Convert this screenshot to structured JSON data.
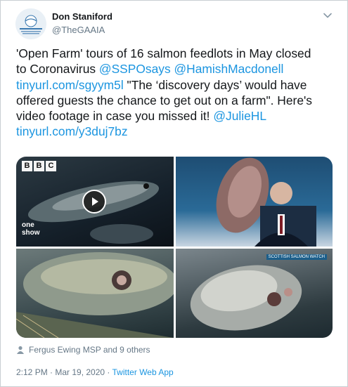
{
  "tweet": {
    "author_name": "Don Staniford",
    "author_handle": "@TheGAAIA",
    "lines": [
      [
        {
          "t": "'Open Farm' tours of 16 salmon feedlots in May closed",
          "link": false
        }
      ],
      [
        {
          "t": "to Coronavirus ",
          "link": false
        },
        {
          "t": "@SSPOsays",
          "link": true
        },
        {
          "t": " ",
          "link": false
        },
        {
          "t": "@HamishMacdonell",
          "link": true
        }
      ],
      [
        {
          "t": "tinyurl.com/sgyym5l",
          "link": true
        },
        {
          "t": " \"The ‘discovery days’ would have",
          "link": false
        }
      ],
      [
        {
          "t": "offered guests the chance to get out on a farm\".  Here's",
          "link": false
        }
      ],
      [
        {
          "t": "video footage in case you missed it! ",
          "link": false
        },
        {
          "t": "@JulieHL",
          "link": true
        }
      ],
      [
        {
          "t": "tinyurl.com/y3duj7bz",
          "link": true
        }
      ]
    ],
    "media": {
      "bbc_letters": [
        "B",
        "B",
        "C"
      ],
      "show_logo_text": "one show",
      "tile4_badge": "SCOTTISH SALMON WATCH"
    },
    "liked_by": "Fergus Ewing MSP and 9 others",
    "timestamp": "2:12 PM · Mar 19, 2020 · ",
    "source_app": "Twitter Web App"
  },
  "colors": {
    "link": "#1b95e0",
    "text": "#14171a",
    "muted": "#657786"
  }
}
